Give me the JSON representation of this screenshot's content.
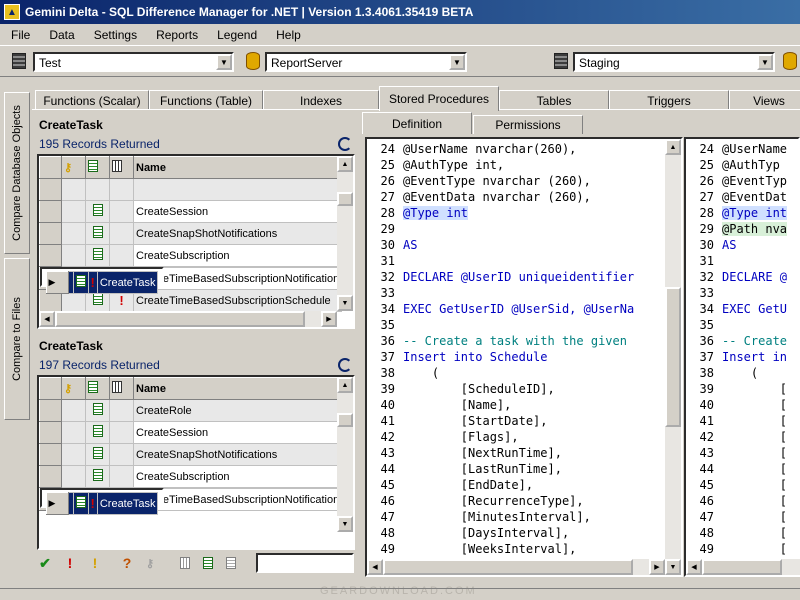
{
  "window": {
    "title": "Gemini Delta - SQL Difference Manager for .NET  |  Version 1.3.4061.35419 BETA"
  },
  "menu": [
    "File",
    "Data",
    "Settings",
    "Reports",
    "Legend",
    "Help"
  ],
  "selectors": {
    "left_db": "Test",
    "left_server": "ReportServer",
    "right_db": "Staging"
  },
  "side_tabs": [
    "Compare Database Objects",
    "Compare to Files"
  ],
  "object_tabs": [
    "Functions (Scalar)",
    "Functions (Table)",
    "Indexes",
    "Stored Procedures",
    "Tables",
    "Triggers",
    "Views"
  ],
  "top_panel": {
    "title": "CreateTask",
    "records": "195 Records Returned",
    "header": "Name",
    "rows": [
      {
        "name": "",
        "flag": ""
      },
      {
        "name": "CreateSession",
        "flag": ""
      },
      {
        "name": "CreateSnapShotNotifications",
        "flag": ""
      },
      {
        "name": "CreateSubscription",
        "flag": ""
      },
      {
        "name": "CreateTask",
        "flag": "!"
      },
      {
        "name": "CreateTimeBasedSubscriptionNotification",
        "flag": ""
      },
      {
        "name": "CreateTimeBasedSubscriptionSchedule",
        "flag": "!"
      }
    ]
  },
  "bottom_panel": {
    "title": "CreateTask",
    "records": "197 Records Returned",
    "header": "Name",
    "rows": [
      {
        "name": "CreateRole",
        "flag": ""
      },
      {
        "name": "CreateSession",
        "flag": ""
      },
      {
        "name": "CreateSnapShotNotifications",
        "flag": ""
      },
      {
        "name": "CreateSubscription",
        "flag": ""
      },
      {
        "name": "CreateTask",
        "flag": "!"
      },
      {
        "name": "CreateTimeBasedSubscriptionNotification",
        "flag": ""
      }
    ]
  },
  "bottom_toolbar": {
    "buttons": [
      "✔",
      "!",
      "!",
      "?",
      "",
      "",
      "",
      ""
    ]
  },
  "detail_tabs": [
    "Definition",
    "Permissions"
  ],
  "left_code": [
    {
      "n": "24",
      "t": "@UserName nvarchar(260),",
      "hl": ""
    },
    {
      "n": "25",
      "t": "@AuthType int,",
      "hl": ""
    },
    {
      "n": "26",
      "t": "@EventType nvarchar (260),",
      "hl": ""
    },
    {
      "n": "27",
      "t": "@EventData nvarchar (260),",
      "hl": ""
    },
    {
      "n": "28",
      "t": "@Type int",
      "hl": "b"
    },
    {
      "n": "29",
      "t": "",
      "hl": ""
    },
    {
      "n": "30",
      "t": "AS",
      "hl": ""
    },
    {
      "n": "31",
      "t": "",
      "hl": ""
    },
    {
      "n": "32",
      "t": "DECLARE @UserID uniqueidentifier",
      "hl": ""
    },
    {
      "n": "33",
      "t": "",
      "hl": ""
    },
    {
      "n": "34",
      "t": "EXEC GetUserID @UserSid, @UserNa",
      "hl": ""
    },
    {
      "n": "35",
      "t": "",
      "hl": ""
    },
    {
      "n": "36",
      "t": "-- Create a task with the given",
      "hl": ""
    },
    {
      "n": "37",
      "t": "Insert into Schedule",
      "hl": ""
    },
    {
      "n": "38",
      "t": "    (",
      "hl": ""
    },
    {
      "n": "39",
      "t": "        [ScheduleID],",
      "hl": ""
    },
    {
      "n": "40",
      "t": "        [Name],",
      "hl": ""
    },
    {
      "n": "41",
      "t": "        [StartDate],",
      "hl": ""
    },
    {
      "n": "42",
      "t": "        [Flags],",
      "hl": ""
    },
    {
      "n": "43",
      "t": "        [NextRunTime],",
      "hl": ""
    },
    {
      "n": "44",
      "t": "        [LastRunTime],",
      "hl": ""
    },
    {
      "n": "45",
      "t": "        [EndDate],",
      "hl": ""
    },
    {
      "n": "46",
      "t": "        [RecurrenceType],",
      "hl": ""
    },
    {
      "n": "47",
      "t": "        [MinutesInterval],",
      "hl": ""
    },
    {
      "n": "48",
      "t": "        [DaysInterval],",
      "hl": ""
    },
    {
      "n": "49",
      "t": "        [WeeksInterval],",
      "hl": ""
    }
  ],
  "right_code": [
    {
      "n": "24",
      "t": "@UserName",
      "hl": ""
    },
    {
      "n": "25",
      "t": "@AuthTyp",
      "hl": ""
    },
    {
      "n": "26",
      "t": "@EventTyp",
      "hl": ""
    },
    {
      "n": "27",
      "t": "@EventDat",
      "hl": ""
    },
    {
      "n": "28",
      "t": "@Type int",
      "hl": "b"
    },
    {
      "n": "29",
      "t": "@Path nva",
      "hl": "g"
    },
    {
      "n": "30",
      "t": "AS",
      "hl": ""
    },
    {
      "n": "31",
      "t": "",
      "hl": ""
    },
    {
      "n": "32",
      "t": "DECLARE @",
      "hl": ""
    },
    {
      "n": "33",
      "t": "",
      "hl": ""
    },
    {
      "n": "34",
      "t": "EXEC GetU",
      "hl": ""
    },
    {
      "n": "35",
      "t": "",
      "hl": ""
    },
    {
      "n": "36",
      "t": "-- Create",
      "hl": ""
    },
    {
      "n": "37",
      "t": "Insert in",
      "hl": ""
    },
    {
      "n": "38",
      "t": "    (",
      "hl": ""
    },
    {
      "n": "39",
      "t": "        [",
      "hl": ""
    },
    {
      "n": "40",
      "t": "        [",
      "hl": ""
    },
    {
      "n": "41",
      "t": "        [",
      "hl": ""
    },
    {
      "n": "42",
      "t": "        [",
      "hl": ""
    },
    {
      "n": "43",
      "t": "        [",
      "hl": ""
    },
    {
      "n": "44",
      "t": "        [",
      "hl": ""
    },
    {
      "n": "45",
      "t": "        [",
      "hl": ""
    },
    {
      "n": "46",
      "t": "        [",
      "hl": ""
    },
    {
      "n": "47",
      "t": "        [",
      "hl": ""
    },
    {
      "n": "48",
      "t": "        [",
      "hl": ""
    },
    {
      "n": "49",
      "t": "        [",
      "hl": ""
    }
  ],
  "watermark": "GEARDOWNLOAD.COM",
  "colors": {
    "selection": "#0a246a",
    "error": "#d00000",
    "keyword": "#0000c0",
    "comment": "#008080",
    "diff_changed": "#d0e0ff",
    "diff_added": "#d8f0d8"
  }
}
